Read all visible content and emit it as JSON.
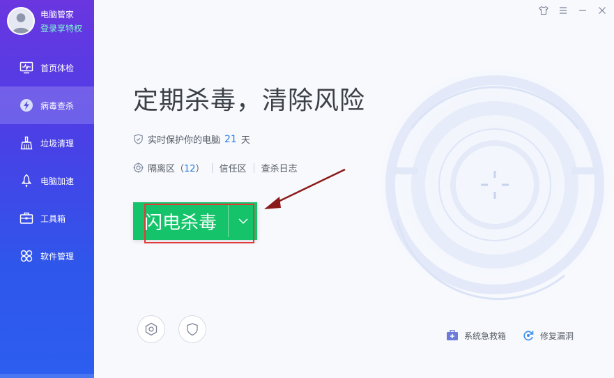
{
  "profile": {
    "app_name": "电脑管家",
    "login_text": "登录享特权"
  },
  "sidebar": {
    "items": [
      {
        "label": "首页体检",
        "icon": "monitor-pulse-icon",
        "active": false
      },
      {
        "label": "病毒查杀",
        "icon": "lightning-icon",
        "active": true
      },
      {
        "label": "垃圾清理",
        "icon": "broom-icon",
        "active": false
      },
      {
        "label": "电脑加速",
        "icon": "rocket-icon",
        "active": false
      },
      {
        "label": "工具箱",
        "icon": "toolbox-icon",
        "active": false
      },
      {
        "label": "软件管理",
        "icon": "apps-icon",
        "active": false
      }
    ]
  },
  "window": {
    "controls": [
      "skin-icon",
      "menu-icon",
      "minimize-icon",
      "close-icon"
    ]
  },
  "main": {
    "headline": "定期杀毒，清除风险",
    "protect_prefix": "实时保护你的电脑",
    "protect_days": "21",
    "protect_suffix": "天",
    "quarantine_label": "隔离区（",
    "quarantine_count": "12",
    "quarantine_close": "）",
    "trust_label": "信任区",
    "log_label": "查杀日志",
    "scan_button": "闪电杀毒"
  },
  "tools": {
    "rescue_label": "系统急救箱",
    "repair_label": "修复漏洞"
  },
  "colors": {
    "accent_green": "#15c46a",
    "link_blue": "#2b7de0",
    "highlight_red": "#e13a3a",
    "sidebar_top": "#6a36e0",
    "sidebar_bottom": "#2c5ef0"
  }
}
